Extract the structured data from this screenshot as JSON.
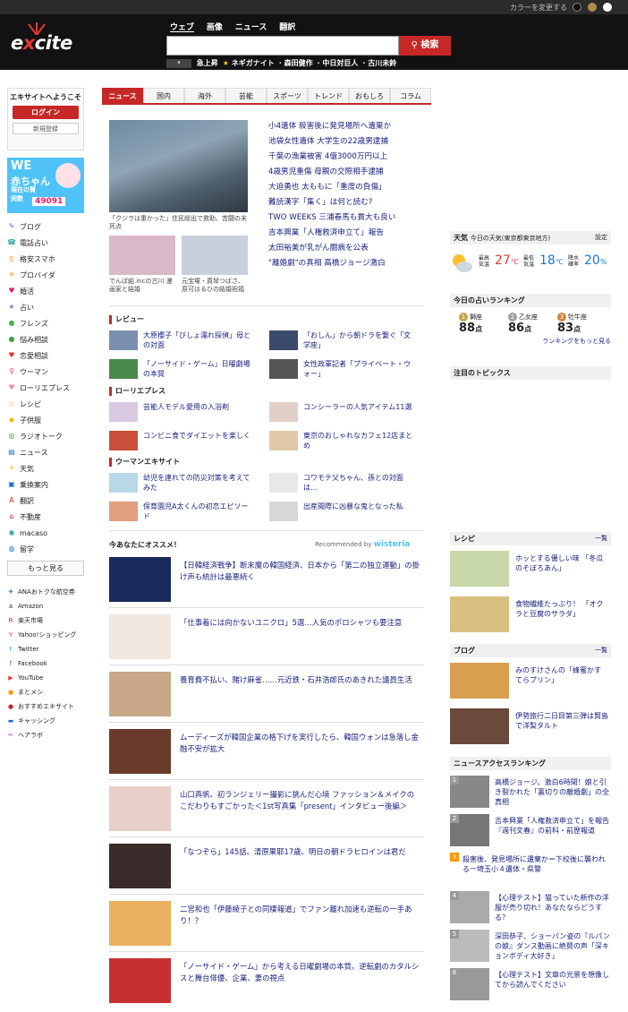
{
  "topbar": {
    "color_label": "カラーを変更する",
    "dots": [
      "#111111",
      "#b08a4a",
      "#ffffff"
    ]
  },
  "header": {
    "logo": "excite",
    "tabs": [
      "ウェブ",
      "画像",
      "ニュース",
      "翻訳"
    ],
    "search_placeholder": "",
    "search_button": "検索",
    "trend_tag": "",
    "trend_items": [
      "急上昇",
      "ネギガナイト",
      "森田健作",
      "中日対巨人",
      "古川未鈴"
    ]
  },
  "left": {
    "welcome": "エキサイトへようこそ",
    "login": "ログイン",
    "register": "新規登録",
    "banner": {
      "line1": "WE",
      "line2": "赤ちゃん",
      "line2b": "プロジェクト",
      "line3": "現在の賛同数",
      "count": "49091"
    },
    "services": [
      {
        "icon": "pen-icon",
        "label": "ブログ",
        "color": "#5c6bc0",
        "glyph": "✎"
      },
      {
        "icon": "phone-icon",
        "label": "電話占い",
        "color": "#26a69a",
        "glyph": "☎"
      },
      {
        "icon": "smartphone-icon",
        "label": "格安スマホ",
        "color": "#ef6c00",
        "glyph": "▯"
      },
      {
        "icon": "provider-icon",
        "label": "プロバイダ",
        "color": "#fb8c00",
        "glyph": "✳"
      },
      {
        "icon": "marriage-icon",
        "label": "婚活",
        "color": "#e91e63",
        "glyph": "♥"
      },
      {
        "icon": "star-icon",
        "label": "占い",
        "color": "#9575cd",
        "glyph": "★"
      },
      {
        "icon": "friends-icon",
        "label": "フレンズ",
        "color": "#4caf50",
        "glyph": "●"
      },
      {
        "icon": "chat-icon",
        "label": "悩み相談",
        "color": "#43a047",
        "glyph": "●"
      },
      {
        "icon": "love-icon",
        "label": "恋愛相談",
        "color": "#e53935",
        "glyph": "♥"
      },
      {
        "icon": "woman-icon",
        "label": "ウーマン",
        "color": "#ec407a",
        "glyph": "♀"
      },
      {
        "icon": "heart-icon",
        "label": "ローリエプレス",
        "color": "#f48fb1",
        "glyph": "♥"
      },
      {
        "icon": "recipe-icon",
        "label": "レシピ",
        "color": "#ff9800",
        "glyph": "♨"
      },
      {
        "icon": "child-icon",
        "label": "子供服",
        "color": "#ffb300",
        "glyph": "◆"
      },
      {
        "icon": "radio-icon",
        "label": "ラジオトーク",
        "color": "#2e7d32",
        "glyph": "◎"
      },
      {
        "icon": "news-icon",
        "label": "ニュース",
        "color": "#1976d2",
        "glyph": "▤"
      },
      {
        "icon": "weather-icon",
        "label": "天気",
        "color": "#fbc02d",
        "glyph": "☀"
      },
      {
        "icon": "train-icon",
        "label": "乗換案内",
        "color": "#1565c0",
        "glyph": "▣"
      },
      {
        "icon": "translate-icon",
        "label": "翻訳",
        "color": "#c62828",
        "glyph": "A"
      },
      {
        "icon": "house-icon",
        "label": "不動産",
        "color": "#c62828",
        "glyph": "⌂"
      },
      {
        "icon": "macaso-icon",
        "label": "macaso",
        "color": "#26a69a",
        "glyph": "◉"
      },
      {
        "icon": "globe-icon",
        "label": "留学",
        "color": "#1976d2",
        "glyph": "◍"
      }
    ],
    "more": "もっと見る",
    "links": [
      {
        "icon": "ana-icon",
        "label": "ANAおトクな航空券",
        "color": "#0d47a1",
        "glyph": "✈"
      },
      {
        "icon": "amazon-icon",
        "label": "Amazon",
        "color": "#222222",
        "glyph": "a"
      },
      {
        "icon": "rakuten-icon",
        "label": "楽天市場",
        "color": "#c62828",
        "glyph": "R"
      },
      {
        "icon": "yahoo-icon",
        "label": "Yahoo!ショッピング",
        "color": "#e53935",
        "glyph": "Y"
      },
      {
        "icon": "twitter-icon",
        "label": "Twitter",
        "color": "#1da1f2",
        "glyph": "t"
      },
      {
        "icon": "facebook-icon",
        "label": "Facebook",
        "color": "#3b5998",
        "glyph": "f"
      },
      {
        "icon": "youtube-icon",
        "label": "YouTube",
        "color": "#e53935",
        "glyph": "▶"
      },
      {
        "icon": "matomeshi-icon",
        "label": "まとメシ",
        "color": "#ff9800",
        "glyph": "●"
      },
      {
        "icon": "excite-icon",
        "label": "おすすめエキサイト",
        "color": "#c62828",
        "glyph": "●"
      },
      {
        "icon": "cashing-icon",
        "label": "キャッシング",
        "color": "#1976d2",
        "glyph": "▬"
      },
      {
        "icon": "hair-icon",
        "label": "ヘアラボ",
        "color": "#9c27b0",
        "glyph": "✂"
      }
    ]
  },
  "news_tabs": [
    "ニュース",
    "国内",
    "海外",
    "芸能",
    "スポーツ",
    "トレンド",
    "おもしろ",
    "コラム"
  ],
  "top_news": {
    "caption_main": "「クジラは重かった」住民総出で救助、苦闘の末死点",
    "thumb1_caption": "でんぱ組.incの古川 漫画家と結婚",
    "thumb2_caption": "元宝塚・真琴つばさ、原可はるひの結婚祝福",
    "headlines": [
      "小4遺体 殺害後に発見場所へ遺棄か",
      "池袋女性遺体 大学生の22歳男逮捕",
      "千葉の漁業被害 4億3000万円以上",
      "4歳男児重傷 母親の交際相手逮捕",
      "大迫勇也 太ももに「重度の負傷」",
      "難読漢字「集く」は何と読む?",
      "TWO WEEKS 三浦春馬も貫大も良い",
      "吉本興業「人権救済申立て」報告",
      "太田裕美が乳がん闘病を公表",
      "\"離婚劇\"の真相 高橋ジョージ激白"
    ]
  },
  "review": {
    "title": "レビュー",
    "items": [
      "大原櫻子「びしょ濡れ探偵」母との対面",
      "「おしん」から朝ドラを繋ぐ「文学座」",
      "「ノーサイド・ゲーム」日曜劇場の本質",
      "女性政軍記者「プライベート・ウォー」"
    ]
  },
  "laurier": {
    "title": "ローリエプレス",
    "items": [
      "芸能人モデル愛用の入浴剤",
      "コンシーラーの人気アイテム11選",
      "コンビニ食でダイエットを楽しく",
      "東京のおしゃれなカフェ12店まとめ"
    ]
  },
  "woman": {
    "title": "ウーマンエキサイト",
    "items": [
      "幼児を連れての防災対策を考えてみた",
      "コワモテ父ちゃん、孫との対面は…",
      "保育園児A太くんの初恋エピソード",
      "出産間際に凶暴な鬼となった私"
    ]
  },
  "recommend": {
    "title": "今あなたにオススメ！",
    "by": "Recommended by",
    "brand": "wisteria",
    "items": [
      "【日韓経済戦争】断末魔の韓国経済、日本から「第二の独立運動」の掛け声も統計は最悪続く",
      "「仕事着には向かないユニクロ」5選…人気のポロシャツも要注意",
      "養育費不払い、賭け麻雀……元近鉄・石井浩郎氏のあきれた議員生活",
      "ムーディーズが韓国企業の格下げを実行したら、韓国ウォンは急落し金融不安が拡大",
      "山口真帆、初ランジェリー撮影に挑んだ心境 ファッション＆メイクのこだわりもすごかった＜1st写真集「present」インタビュー後編＞",
      "「なつぞら」145話。清原果耶17歳、明日の朝ドラヒロインは君だ",
      "二宮和也「伊藤綾子との同棲報道」でファン離れ加速も逆転の一手あり！？",
      "「ノーサイド・ゲーム」から考える日曜劇場の本質。逆転劇のカタルシスと舞台俳優、企業、妻の視点"
    ]
  },
  "weather": {
    "title": "天気",
    "location": "今日の天気(東京都東京地方)",
    "settings": "設定",
    "max_label": "最高気温",
    "max": "27",
    "min_label": "最低気温",
    "min": "18",
    "unit": "℃",
    "rain_label": "降水確率",
    "rain": "20",
    "rain_unit": "%"
  },
  "fortune": {
    "title": "今日の占いランキング",
    "items": [
      {
        "rank": "1",
        "sign": "獅座",
        "points": "88",
        "color": "#c8a24a"
      },
      {
        "rank": "2",
        "sign": "乙女座",
        "points": "86",
        "color": "#9e9e9e"
      },
      {
        "rank": "3",
        "sign": "牡牛座",
        "points": "83",
        "color": "#d08440"
      }
    ],
    "unit": "点",
    "more": "ランキングをもっと見る"
  },
  "topics": {
    "title": "注目のトピックス"
  },
  "recipe": {
    "title": "レシピ",
    "more": "一覧",
    "items": [
      "ホッとする優しい味 「冬瓜のそぼろあん」",
      "食物繊維たっぷり！ 「オクラと豆腐のサラダ」"
    ]
  },
  "blog": {
    "title": "ブログ",
    "more": "一覧",
    "items": [
      "みのすけさんの「蜂蜜かすてらプリン」",
      "伊勢旅行二日目第三弾は賢島で洋梨タルト"
    ]
  },
  "access": {
    "title": "ニュースアクセスランキング",
    "items": [
      {
        "n": "1",
        "t": "高橋ジョージ、激白6時間！娘と引き裂かれた「裏切りの離婚劇」の全真相"
      },
      {
        "n": "2",
        "t": "吉本興業「人権救済申立て」を報告 『週刊文春』の前科・前歴報道"
      },
      {
        "n": "3",
        "t": "殺害後、発見場所に遺棄か＝下校後に襲われる一埼玉小４遺体・県警"
      },
      {
        "n": "4",
        "t": "【心理テスト】猫っていた新作の洋服が売り切れ！あなたならどうする？"
      },
      {
        "n": "5",
        "t": "深田恭子、ショーパン姿の『ルパンの娘』ダンス動画に絶賛の声「深キョンボディ大好き」"
      },
      {
        "n": "6",
        "t": "【心理テスト】文章の光景を想像してから読んでください"
      }
    ]
  }
}
